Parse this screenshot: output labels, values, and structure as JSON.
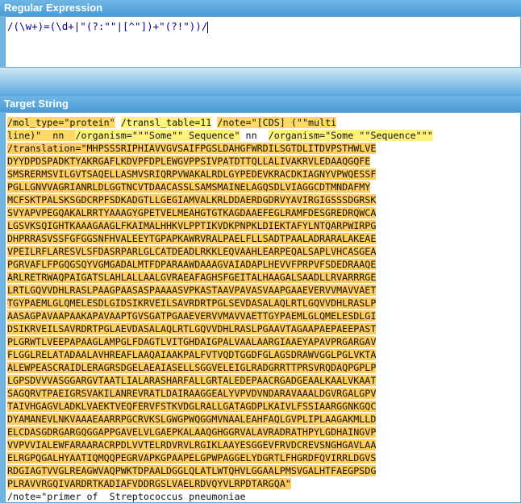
{
  "sections": {
    "regex_title": "Regular Expression",
    "target_title": "Target String"
  },
  "regex": {
    "pattern": "/(\\w+)=(\\d+|\"(?:\"\"|[^\"])+\"(?!\"))/"
  },
  "target": {
    "line1": [
      {
        "text": "/mol_type=\"protein\"",
        "hl": "m1"
      },
      {
        "text": " ",
        "hl": "sp"
      },
      {
        "text": "/transl_table=11",
        "hl": "m2"
      },
      {
        "text": " ",
        "hl": "sp"
      },
      {
        "text": "/note=\"[CDS] (\"\"multi",
        "hl": "m1"
      }
    ],
    "line2": [
      {
        "text": "line)\"  nn  ",
        "hl": "m1"
      },
      {
        "text": "/organism=\"\"\"Some\"\" Sequence\"",
        "hl": "m2"
      },
      {
        "text": " nn  ",
        "hl": "sp"
      },
      {
        "text": "/organism=\"Some \"\"Sequence\"\"\"",
        "hl": "m2"
      }
    ],
    "translation_lines": [
      "/translation=\"MHPSSSRIPHIAVVGVSAIFPGSLDAHGFWRDILSGTDLITDVPSTHWLVE",
      "DYYDPDSPADKTYAKRGAFLKDVPFDPLEWGVPPSIVPATDTTQLLALIVAKRVLEDAAQGQFE",
      "SMSRERMSVILGVTSAQELLASMVSRIQRPVWAKALRDLGYPEDEVKRACDKIAGNYVPWQESSF",
      "PGLLGNVVAGRIANRLDLGGTNCVTDAACASSLSAMSMAINELAGQSDLVIAGGCDTMNDAFMY",
      "MCFSKTPALSKSGDCRPFSDKADGTLLGEGIAMVALKRLDDAERDGDRVYAVIRGIGSSSDGRSK",
      "SVYAPVPEGQAKALRRTYAAAGYGPETVELMEAHGTGTKAGDAAEFEGLRAMFDESGREDRQWCA",
      "LGSVKSQIGHTKAAAGAAGLFKAIMALHHKVLPPTIKVDKPNPKLDIEKTAFYLNTQARPWIRPG",
      "DHPRRASVSSFGFGGSNFHVALEEYTGPAPKAWRVRALPAELFLLSADTPAALADRARALAKEAE",
      "VPEILRFLARESVLSFDASRPARLGLCATDEADLRKKLEQVAAHLEARPEQALSAPLVHCASGEA",
      "PGRVAFLFPGQGSQYVGMGADALMTFDPARAAWDAAAGVAIADAPLHEVVFPRPVFSDEDRAAQE",
      "ARLRETRWAQPAIGATSLAHLALLAALGVRAEAFAGHSFGEITALHAAGALSAADLLRVARRRGE",
      "LRTLGQVVDHLRASLPAAGPAASASPAAAASVPKASTAAVPAVASVAAPGAAEVERVVMAVVAET",
      "TGYPAEMLGLQMELESDLGIDSIKRVEILSAVRDRTPGLSEVDASALAQLRTLGQVVDHLRASLP",
      "AASAGPAVAAPAAKAPAVAAPTGVSGATPGAAEVERVVMAVVAETTGYPAEMLGLQMELESDLGI",
      "DSIKRVEILSAVRDRTPGLAEVDASALAQLRTLGQVVDHLRASLPGAAVTAGAAPAEPAEEPAST",
      "PLGRWTLVEEPAPAAGLAMPGLFDAGTLVITGHDAIGPALVAALAARGIAAEYAPAVPRGARGAV",
      "FLGGLRELATADAALAVHREAFLAAQAIAAKPALFVTVQDTGGDFGLAGSDRAWVGGLPGLVKTA",
      "ALEWPEASCRAIDLERAGRSDGELAEAIASELLSGGVELEIGLRADGRRTTPRSVRQDAQPGPLP",
      "LGPSDVVVASGGARGVTAATLIALARASHARFALLGRTALEDEPAACRGADGEAALKAALVKAAT",
      "SAGQRVTPAEIGRSVAKILANREVRATLDAIRAAGGEALYVPVDVNDARAVAAALDGVRGALGPV",
      "TAIVHGAGVLADKLVAEKTVEQFERVFSTKVDGLRALLGATAGDPLKAIVLFSSIAARGGNKGQC",
      "DYAMANEVLNKVAAAEAARRPGCRVKSLGWGPWQGGMVNAALEAHFAQLGVPLIPLAAGAKMLLD",
      "ELCDASGDRGARGQGGAPPGAVELVLGAEPKALAAQGHGGRVALAVRADRATHPYLGDHAINGVP",
      "VVPVVIALEWFARAARACRPDLVVTELRDVRVLRGIKLAAYESGGEVFRVDCREVSNGHGAVLAA",
      "ELRGPQGALHYAATIQMQQPEGRVAPKGPAAPELGPWPAGGELYDGRTLFHGRDFQVIRRLDGVS",
      "RDGIAGTVVGLREAGWVAQPWKTDPAALDGGLQLATLWTQHVLGGAALPMSVGALHTFAEGPSDG",
      "PLRAVVRGQIVARDRTKADIAFVDDRGSLVAELRDVQYVLRPDTARGQA\""
    ],
    "last_line": "/note=\"primer of  Streptococcus pneumoniae"
  }
}
